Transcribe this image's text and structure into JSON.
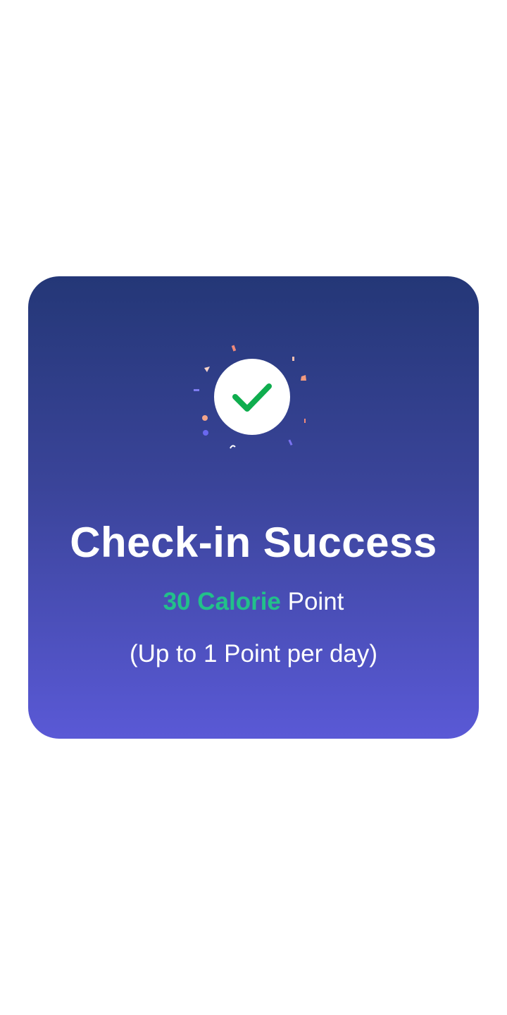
{
  "dialog": {
    "title": "Check-in Success",
    "points_amount": "30 Calorie",
    "points_label": "Point",
    "limit_note": "(Up to 1 Point per day)",
    "icon": "check-circle-icon"
  },
  "colors": {
    "card_top": "#243777",
    "card_bottom": "#5a59d6",
    "accent_green": "#22c08a",
    "check_green": "#0fad4e"
  }
}
